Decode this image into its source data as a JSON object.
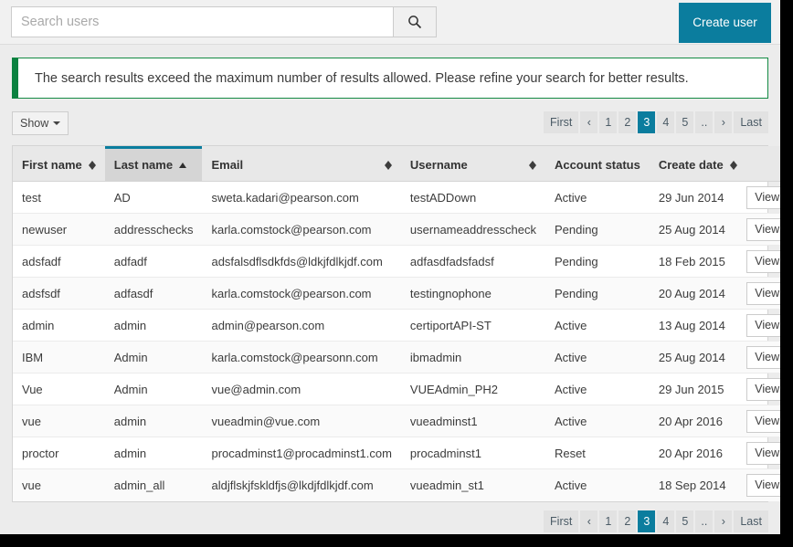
{
  "search": {
    "placeholder": "Search users",
    "value": "",
    "icon": "search-icon",
    "button_label": ""
  },
  "header": {
    "create_user_label": "Create user",
    "accent_color": "#0b7d9e"
  },
  "alert": {
    "message": "The search results exceed the maximum number of results allowed. Please refine your search for better results.",
    "border_color": "#0b8140"
  },
  "toolbar": {
    "show_label": "Show",
    "show_caret_icon": "caret-down-icon"
  },
  "pagination": {
    "first_label": "First",
    "prev_label": "‹",
    "pages": [
      "1",
      "2",
      "3",
      "4",
      "5",
      ".."
    ],
    "active_page": "3",
    "next_label": "›",
    "last_label": "Last"
  },
  "table": {
    "columns": [
      {
        "label": "First name",
        "sort": "both"
      },
      {
        "label": "Last name",
        "sort": "asc"
      },
      {
        "label": "Email",
        "sort": "both"
      },
      {
        "label": "Username",
        "sort": "both"
      },
      {
        "label": "Account status",
        "sort": "none"
      },
      {
        "label": "Create date",
        "sort": "both"
      },
      {
        "label": "",
        "sort": "none"
      }
    ],
    "row_action_label": "View",
    "row_action_caret": "caret-down-icon",
    "rows": [
      {
        "first_name": "test",
        "last_name": "AD",
        "email": "sweta.kadari@pearson.com",
        "username": "testADDown",
        "status": "Active",
        "create_date": "29 Jun 2014"
      },
      {
        "first_name": "newuser",
        "last_name": "addresschecks",
        "email": "karla.comstock@pearson.com",
        "username": "usernameaddresscheck",
        "status": "Pending",
        "create_date": "25 Aug 2014"
      },
      {
        "first_name": "adsfadf",
        "last_name": "adfadf",
        "email": "adsfalsdflsdkfds@ldkjfdlkjdf.com",
        "username": "adfasdfadsfadsf",
        "status": "Pending",
        "create_date": "18 Feb 2015"
      },
      {
        "first_name": "adsfsdf",
        "last_name": "adfasdf",
        "email": "karla.comstock@pearson.com",
        "username": "testingnophone",
        "status": "Pending",
        "create_date": "20 Aug 2014"
      },
      {
        "first_name": "admin",
        "last_name": "admin",
        "email": "admin@pearson.com",
        "username": "certiportAPI-ST",
        "status": "Active",
        "create_date": "13 Aug 2014"
      },
      {
        "first_name": "IBM",
        "last_name": "Admin",
        "email": "karla.comstock@pearsonn.com",
        "username": "ibmadmin",
        "status": "Active",
        "create_date": "25 Aug 2014"
      },
      {
        "first_name": "Vue",
        "last_name": "Admin",
        "email": "vue@admin.com",
        "username": "VUEAdmin_PH2",
        "status": "Active",
        "create_date": "29 Jun 2015"
      },
      {
        "first_name": "vue",
        "last_name": "admin",
        "email": "vueadmin@vue.com",
        "username": "vueadminst1",
        "status": "Active",
        "create_date": "20 Apr 2016"
      },
      {
        "first_name": "proctor",
        "last_name": "admin",
        "email": "procadminst1@procadminst1.com",
        "username": "procadminst1",
        "status": "Reset",
        "create_date": "20 Apr 2016"
      },
      {
        "first_name": "vue",
        "last_name": "admin_all",
        "email": "aldjflskjfskldfjs@lkdjfdlkjdf.com",
        "username": "vueadmin_st1",
        "status": "Active",
        "create_date": "18 Sep 2014"
      }
    ]
  }
}
